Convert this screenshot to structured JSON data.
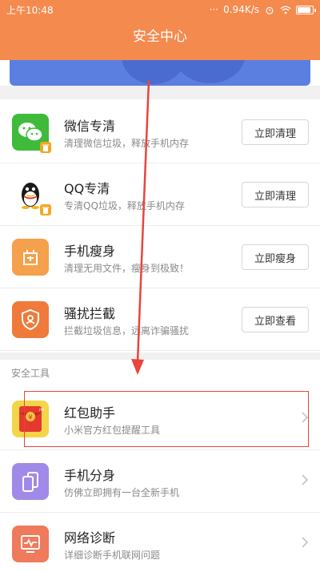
{
  "statusbar": {
    "time": "上午10:48",
    "speed": "0.94K/s"
  },
  "header": {
    "title": "安全中心"
  },
  "cleaners": [
    {
      "name": "微信专清",
      "desc": "清理微信垃圾，释放手机内存",
      "button": "立即清理",
      "icon": "wechat-icon",
      "color": "#3fba3a"
    },
    {
      "name": "QQ专清",
      "desc": "专清QQ垃圾，释放手机内存",
      "button": "立即清理",
      "icon": "qq-penguin-icon",
      "color": "#ffffff"
    },
    {
      "name": "手机瘦身",
      "desc": "清理无用文件，瘦身到极致！",
      "button": "立即瘦身",
      "icon": "slim-phone-icon",
      "color": "#f5a04a"
    },
    {
      "name": "骚扰拦截",
      "desc": "拦截垃圾信息，远离诈骗骚扰",
      "button": "立即查看",
      "icon": "shield-icon",
      "color": "#ef7a3a"
    }
  ],
  "tools_section": {
    "label": "安全工具"
  },
  "tools": [
    {
      "name": "红包助手",
      "desc": "小米官方红包提醒工具",
      "icon": "red-envelope-icon",
      "color": "#f3d54a"
    },
    {
      "name": "手机分身",
      "desc": "仿佛立即拥有一台全新手机",
      "icon": "dual-phone-icon",
      "color": "#a08ae8"
    },
    {
      "name": "网络诊断",
      "desc": "详细诊断手机联网问题",
      "icon": "network-monitor-icon",
      "color": "#ef7a5c"
    }
  ],
  "annotation_color": "#e8453c"
}
